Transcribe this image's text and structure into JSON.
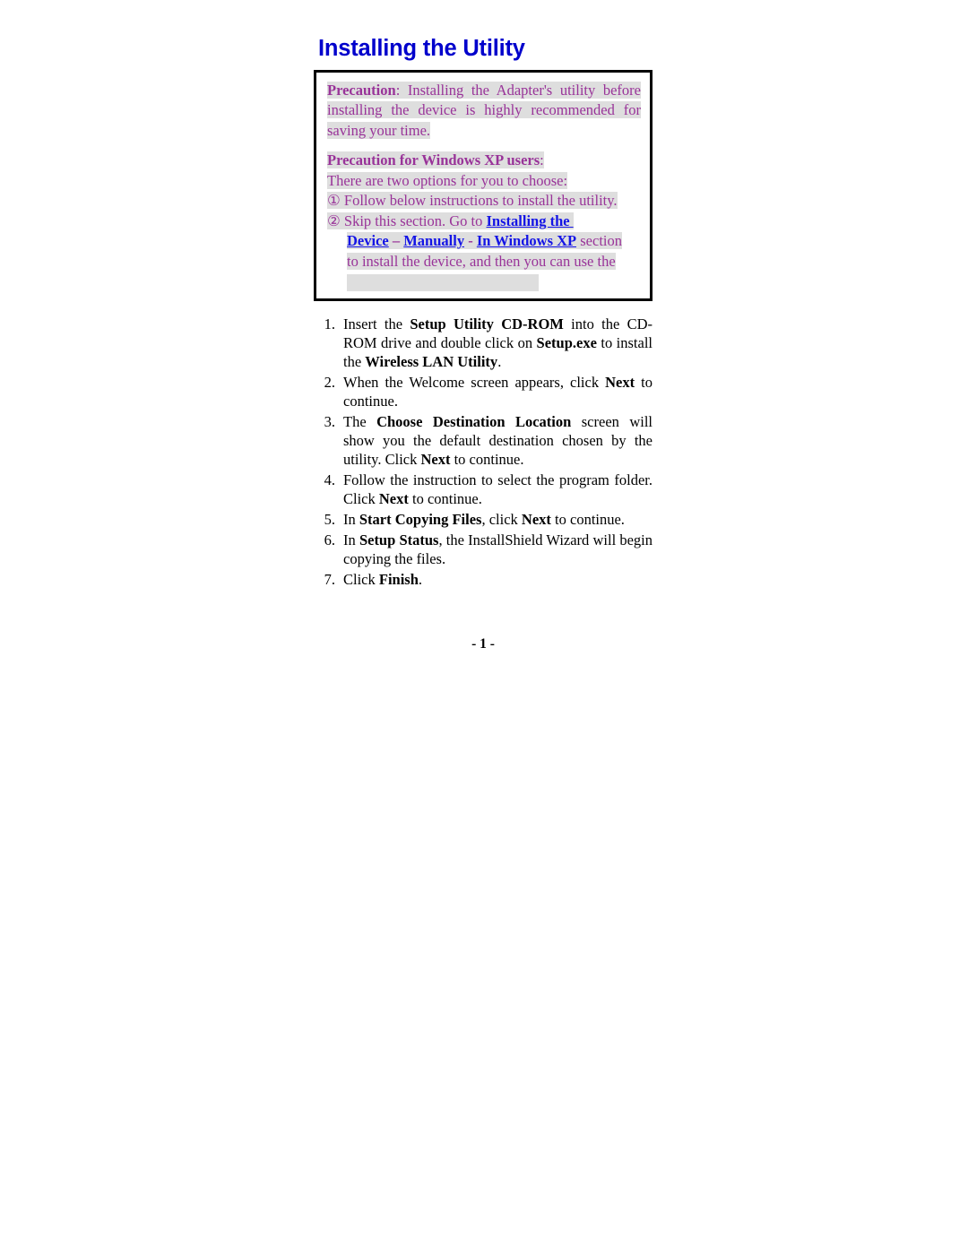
{
  "document": {
    "title": "Installing the Utility",
    "footer": "- 1 -"
  },
  "colors": {
    "heading_blue": "#0000CC",
    "precaution_purple": "#993399",
    "link_blue": "#1414E6",
    "highlight_gray": "#DEDEDE",
    "box_border": "#000000",
    "body_text": "#000000"
  },
  "precaution_box": {
    "para1": {
      "label": "Precaution",
      "colon": ":",
      "text": " Installing the Adapter's utility before installing the device is highly recommended for saving your time."
    },
    "para2_heading": {
      "label": "Precaution for Windows XP users",
      "colon": ":"
    },
    "intro": "There are two options for you to choose:",
    "options": [
      {
        "marker": "①",
        "text": "Follow below instructions to install the utility."
      },
      {
        "marker": "②",
        "text_before": "Skip this section. Go to ",
        "link1": "Installing the",
        "link2": "Device",
        "sep1": " – ",
        "link3": "Manually",
        "sep2": " - ",
        "link4": "In Windows XP",
        "text_after": " section",
        "text_tail": "to install the device, and then you can use the",
        "text_blank": ""
      }
    ]
  },
  "steps": [
    {
      "number": "1.",
      "segments": [
        {
          "text": "Insert the ",
          "bold": false
        },
        {
          "text": "Setup Utility CD-ROM",
          "bold": true
        },
        {
          "text": " into the CD-ROM drive and double click on ",
          "bold": false
        },
        {
          "text": "Setup.exe",
          "bold": true
        },
        {
          "text": " to install the ",
          "bold": false
        },
        {
          "text": "Wireless LAN Utility",
          "bold": true
        },
        {
          "text": ".",
          "bold": false
        }
      ],
      "justify": true
    },
    {
      "number": "2.",
      "segments": [
        {
          "text": "When the Welcome screen appears, click ",
          "bold": false
        },
        {
          "text": "Next",
          "bold": true
        },
        {
          "text": " to continue.",
          "bold": false
        }
      ],
      "justify": true
    },
    {
      "number": "3.",
      "segments": [
        {
          "text": "The ",
          "bold": false
        },
        {
          "text": "Choose Destination Location",
          "bold": true
        },
        {
          "text": " screen will show you the default destination chosen by the utility. Click ",
          "bold": false
        },
        {
          "text": "Next",
          "bold": true
        },
        {
          "text": " to continue.",
          "bold": false
        }
      ],
      "justify": true
    },
    {
      "number": "4.",
      "segments": [
        {
          "text": "Follow the instruction to select the program folder. Click ",
          "bold": false
        },
        {
          "text": "Next",
          "bold": true
        },
        {
          "text": " to continue.",
          "bold": false
        }
      ],
      "justify": true
    },
    {
      "number": "5.",
      "segments": [
        {
          "text": "In ",
          "bold": false
        },
        {
          "text": "Start Copying Files",
          "bold": true
        },
        {
          "text": ", click ",
          "bold": false
        },
        {
          "text": "Next",
          "bold": true
        },
        {
          "text": " to continue.",
          "bold": false
        }
      ],
      "justify": true
    },
    {
      "number": "6.",
      "segments": [
        {
          "text": "In ",
          "bold": false
        },
        {
          "text": "Setup Status",
          "bold": true
        },
        {
          "text": ", the InstallShield Wizard will begin copying the files.",
          "bold": false
        }
      ],
      "justify": true
    },
    {
      "number": "7.",
      "segments": [
        {
          "text": "Click ",
          "bold": false
        },
        {
          "text": "Finish",
          "bold": true
        },
        {
          "text": ".",
          "bold": false
        }
      ],
      "justify": false
    }
  ]
}
